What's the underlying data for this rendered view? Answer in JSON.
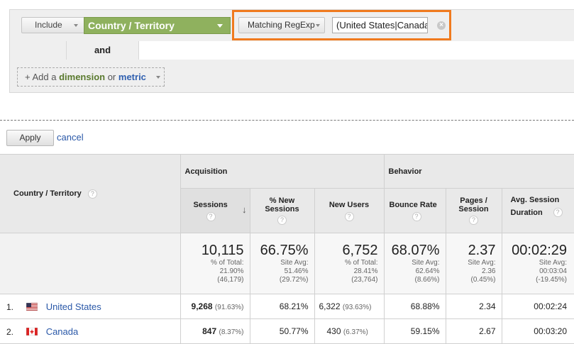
{
  "filter": {
    "include_label": "Include",
    "dimension_label": "Country / Territory",
    "match_label": "Matching RegExp",
    "regex_value": "(United States|Canada)",
    "clear_glyph": "×",
    "and_label": "and",
    "add_prefix": "+ Add a ",
    "add_dimension": "dimension",
    "add_or": " or ",
    "add_metric": "metric"
  },
  "actions": {
    "apply_label": "Apply",
    "cancel_label": "cancel"
  },
  "table": {
    "dim_header": "Country / Territory",
    "group_acquisition": "Acquisition",
    "group_behavior": "Behavior",
    "columns": {
      "sessions": "Sessions",
      "new_sessions": "% New Sessions",
      "new_users": "New Users",
      "bounce": "Bounce Rate",
      "pages": "Pages / Session",
      "duration": "Avg. Session Duration"
    },
    "totals": {
      "sessions": "10,115",
      "sessions_sub1": "% of Total:",
      "sessions_sub2": "21.90%",
      "sessions_sub3": "(46,179)",
      "new_sessions": "66.75%",
      "new_sessions_sub1": "Site Avg:",
      "new_sessions_sub2": "51.46%",
      "new_sessions_sub3": "(29.72%)",
      "new_users": "6,752",
      "new_users_sub1": "% of Total:",
      "new_users_sub2": "28.41%",
      "new_users_sub3": "(23,764)",
      "bounce": "68.07%",
      "bounce_sub1": "Site Avg:",
      "bounce_sub2": "62.64%",
      "bounce_sub3": "(8.66%)",
      "pages": "2.37",
      "pages_sub1": "Site Avg:",
      "pages_sub2": "2.36",
      "pages_sub3": "(0.45%)",
      "duration": "00:02:29",
      "duration_sub1": "Site Avg:",
      "duration_sub2": "00:03:04",
      "duration_sub3": "(-19.45%)"
    },
    "rows": [
      {
        "index": "1.",
        "country": "United States",
        "flag": "us-flag-icon",
        "sessions": "9,268",
        "sessions_pct": "(91.63%)",
        "new_sessions": "68.21%",
        "new_users": "6,322",
        "new_users_pct": "(93.63%)",
        "bounce": "68.88%",
        "pages": "2.34",
        "duration": "00:02:24"
      },
      {
        "index": "2.",
        "country": "Canada",
        "flag": "canada-flag-icon",
        "sessions": "847",
        "sessions_pct": "(8.37%)",
        "new_sessions": "50.77%",
        "new_users": "430",
        "new_users_pct": "(6.37%)",
        "bounce": "59.15%",
        "pages": "2.67",
        "duration": "00:03:20"
      }
    ]
  },
  "colors": {
    "accent_orange": "#f07a1e",
    "dimension_green": "#8fb15e",
    "link_blue": "#2a58a8"
  }
}
